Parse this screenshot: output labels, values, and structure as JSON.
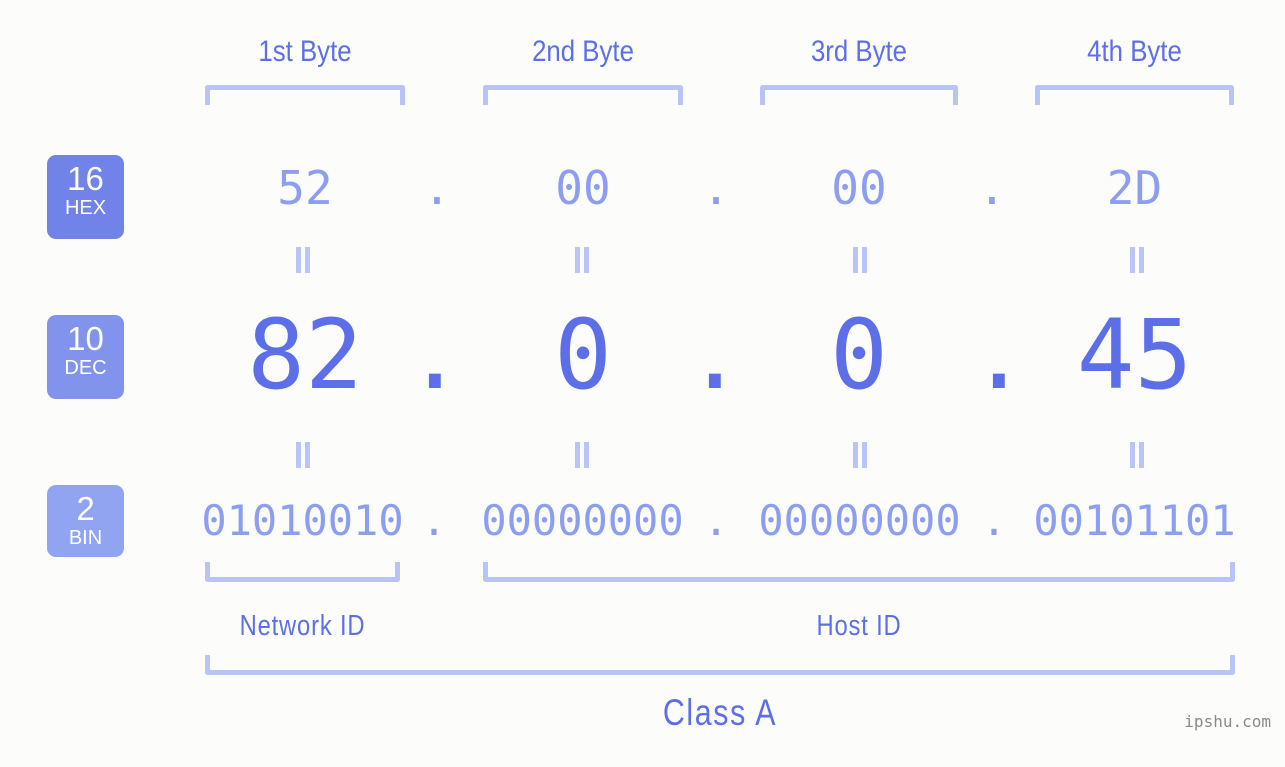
{
  "background_color": "#fcfdfa",
  "accent_colors": {
    "strong_blue": "#5c6ee8",
    "mid_blue": "#8d9ef0",
    "light_blue": "#b9c3f7",
    "badge_hex": "#7182e8",
    "badge_dec": "#8293ee",
    "badge_bin": "#90a4f1",
    "watermark_gray": "#8a8a8a"
  },
  "byte_headers": [
    {
      "label": "1st Byte"
    },
    {
      "label": "2nd Byte"
    },
    {
      "label": "3rd Byte"
    },
    {
      "label": "4th Byte"
    }
  ],
  "radix_badges": [
    {
      "number": "16",
      "name": "HEX"
    },
    {
      "number": "10",
      "name": "DEC"
    },
    {
      "number": "2",
      "name": "BIN"
    }
  ],
  "rows": {
    "hex": {
      "octets": [
        "52",
        "00",
        "00",
        "2D"
      ],
      "separator": "."
    },
    "dec": {
      "octets": [
        "82",
        "0",
        "0",
        "45"
      ],
      "separator": "."
    },
    "bin": {
      "octets": [
        "01010010",
        "00000000",
        "00000000",
        "00101101"
      ],
      "separator": "."
    }
  },
  "equals_marker": "=",
  "sections": [
    {
      "label": "Network ID"
    },
    {
      "label": "Host ID"
    }
  ],
  "class": {
    "label": "Class A"
  },
  "watermark": {
    "text": "ipshu.com"
  }
}
